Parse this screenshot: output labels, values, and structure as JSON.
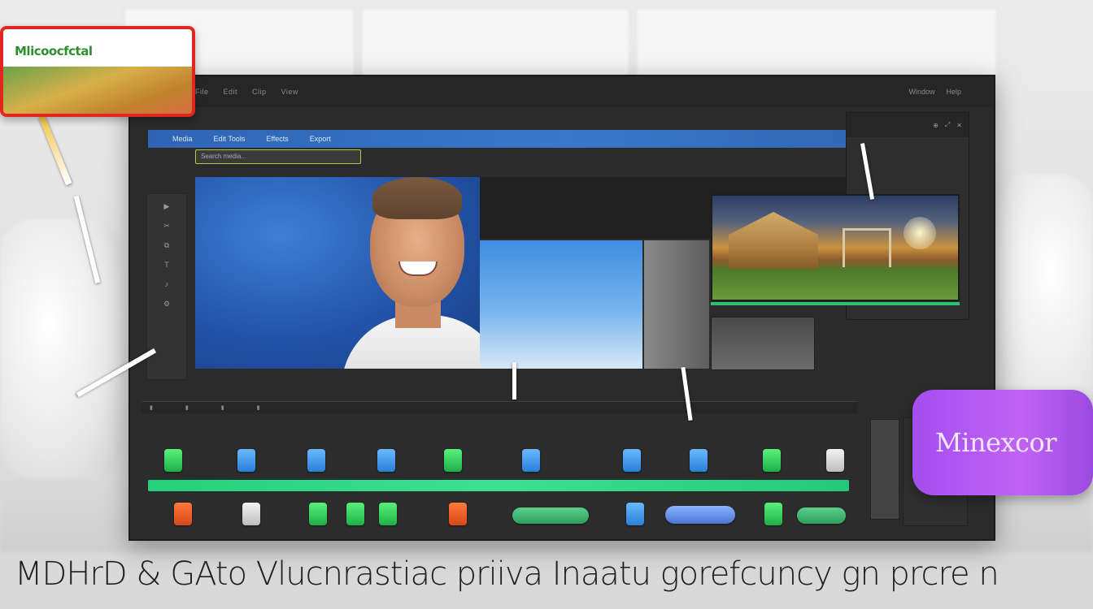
{
  "logo_card": {
    "text": "Mlicoocfctal"
  },
  "menubar": {
    "items": [
      "File",
      "Edit",
      "Clip",
      "View"
    ],
    "right_items": [
      "Window",
      "Help"
    ]
  },
  "blue_header": {
    "items": [
      "Media",
      "Edit Tools",
      "Effects",
      "Export"
    ]
  },
  "search": {
    "placeholder": "Search media..."
  },
  "left_tools": [
    "▶",
    "✂",
    "⧉",
    "T",
    "♪",
    "⚙"
  ],
  "purple_badge": {
    "text": "Minexcor"
  },
  "caption": {
    "text": "MDHrD & GAto Vlucnrastiac priiva Inaatu gorefcuncy gn prcre n"
  },
  "colors": {
    "accent_blue": "#3a78c9",
    "track_green": "#3de091",
    "badge_purple": "#b35cf4",
    "logo_border": "#e3251f"
  }
}
